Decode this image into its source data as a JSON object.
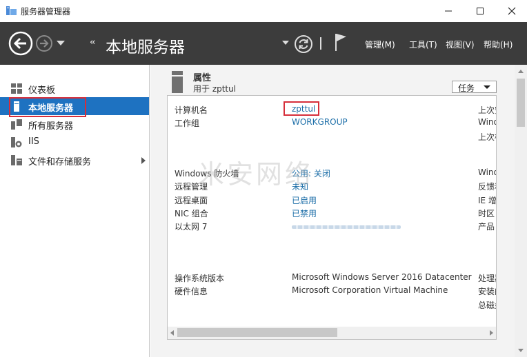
{
  "window": {
    "title": "服务器管理器",
    "icons": {
      "app": "server-manager-icon",
      "min": "minimize-icon",
      "max": "maximize-icon",
      "close": "close-icon"
    }
  },
  "header": {
    "breadcrumb_arrows": "‹‹",
    "title": "本地服务器",
    "menus": [
      "管理(M)",
      "工具(T)",
      "视图(V)",
      "帮助(H)"
    ]
  },
  "sidebar": {
    "items": [
      {
        "label": "仪表板",
        "icon": "dashboard-icon"
      },
      {
        "label": "本地服务器",
        "icon": "server-icon",
        "active": true
      },
      {
        "label": "所有服务器",
        "icon": "servers-icon"
      },
      {
        "label": "IIS",
        "icon": "iis-icon"
      },
      {
        "label": "文件和存储服务",
        "icon": "storage-icon",
        "expandable": true
      }
    ]
  },
  "properties": {
    "title": "属性",
    "subtitle": "用于 zpttul",
    "tasks_label": "任务",
    "rows": [
      {
        "label": "计算机名",
        "value": "zpttul"
      },
      {
        "label": "工作组",
        "value": "WORKGROUP"
      },
      {
        "label": "Windows 防火墙",
        "value": "公用: 关闭"
      },
      {
        "label": "远程管理",
        "value": "未知"
      },
      {
        "label": "远程桌面",
        "value": "已启用"
      },
      {
        "label": "NIC 组合",
        "value": "已禁用"
      },
      {
        "label": "以太网 7",
        "value": ""
      },
      {
        "label": "操作系统版本",
        "value": "Microsoft Windows Server 2016 Datacenter"
      },
      {
        "label": "硬件信息",
        "value": "Microsoft Corporation Virtual Machine"
      }
    ],
    "right_column": [
      "上次安",
      "Wind",
      "上次检",
      "Wind",
      "反馈和",
      "IE 增",
      "时区",
      "产品",
      "处理器",
      "安装的",
      "总磁盘"
    ]
  },
  "watermark": "米安网络",
  "colors": {
    "header_bg": "#3c3c3c",
    "active_bg": "#1e72c1",
    "link": "#1c6ea8",
    "highlight": "#d62e3a"
  }
}
